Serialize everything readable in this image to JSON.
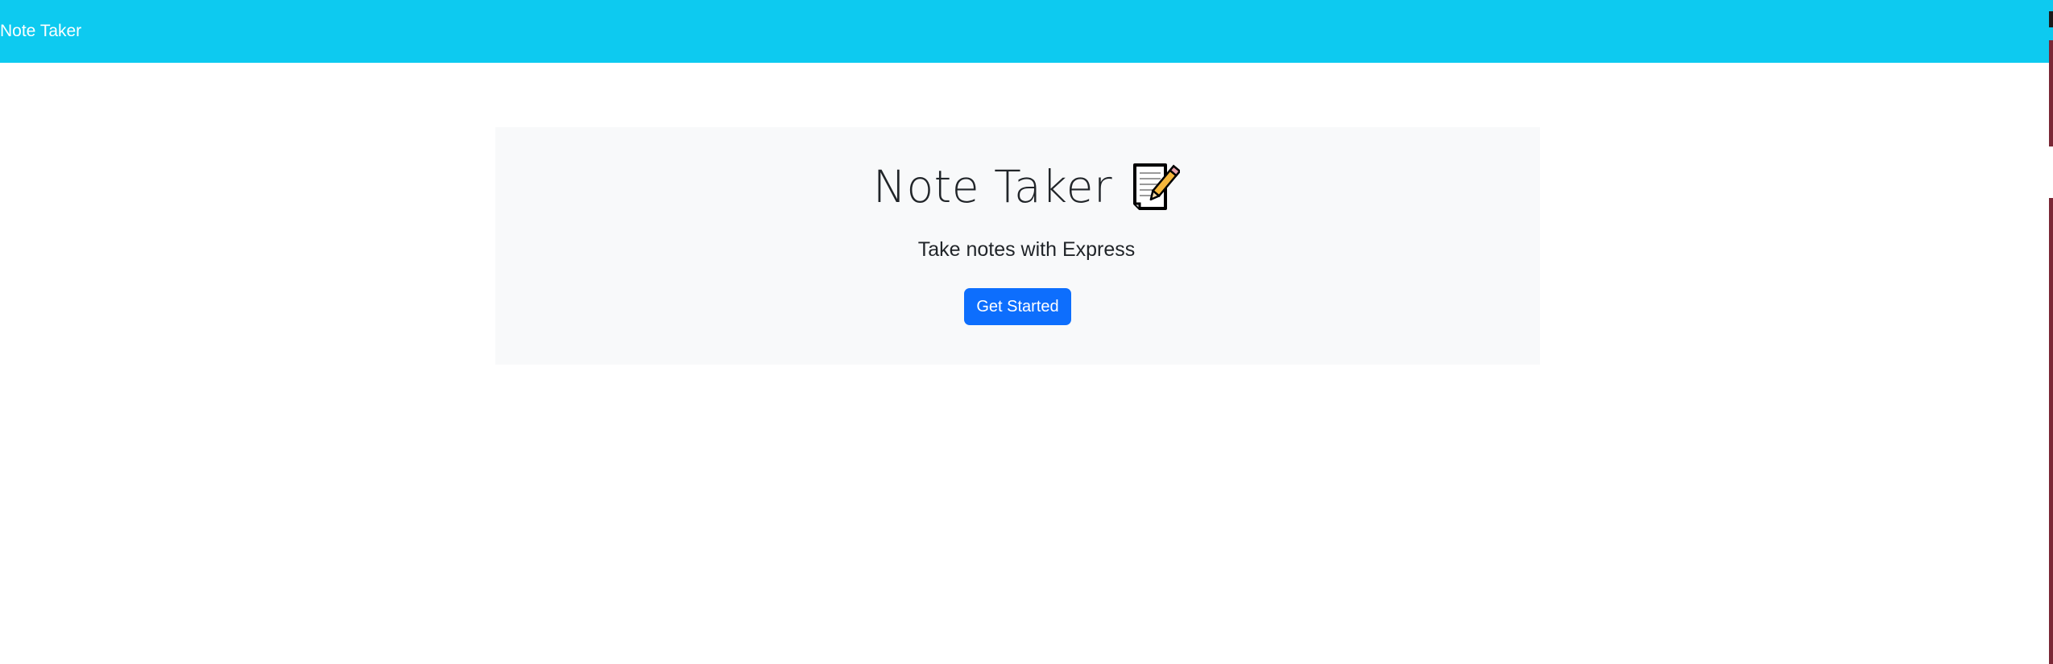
{
  "navbar": {
    "brand": "Note Taker",
    "color": "#0dcaf0"
  },
  "hero": {
    "title": "Note Taker",
    "title_icon": "memo-icon",
    "subtitle": "Take notes with Express",
    "button_label": "Get Started",
    "button_color": "#0d6efd",
    "background": "#f8f9fa"
  }
}
